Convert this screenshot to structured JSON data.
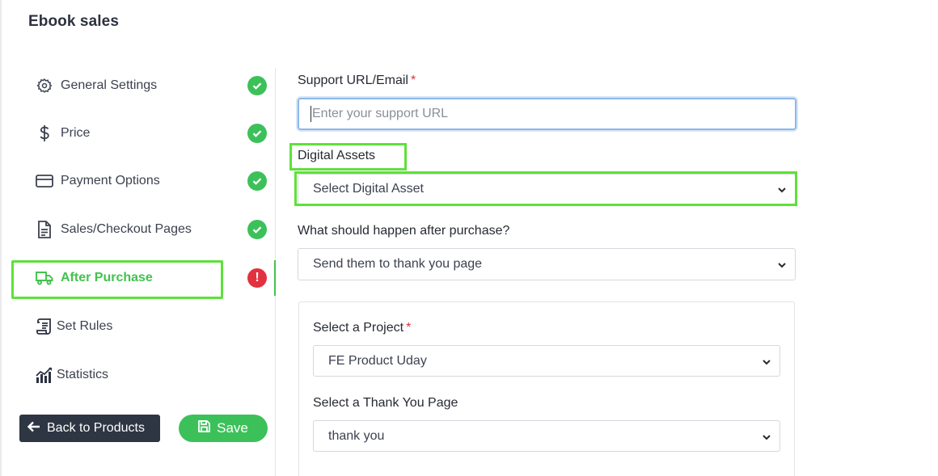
{
  "page": {
    "title": "Ebook sales"
  },
  "sidebar": {
    "items": [
      {
        "label": "General Settings",
        "icon": "gear-icon",
        "status": "complete"
      },
      {
        "label": "Price",
        "icon": "dollar-icon",
        "status": "complete"
      },
      {
        "label": "Payment Options",
        "icon": "credit-card-icon",
        "status": "complete"
      },
      {
        "label": "Sales/Checkout Pages",
        "icon": "document-icon",
        "status": "complete"
      },
      {
        "label": "After Purchase",
        "icon": "truck-icon",
        "status": "error",
        "active": true
      },
      {
        "label": "Set Rules",
        "icon": "scroll-icon"
      },
      {
        "label": "Statistics",
        "icon": "chart-icon"
      }
    ],
    "status_error_glyph": "!",
    "back_label": "Back to Products",
    "save_label": "Save"
  },
  "form": {
    "support": {
      "label": "Support URL/Email",
      "required": "*",
      "placeholder": "Enter your support URL"
    },
    "digital_assets": {
      "label": "Digital Assets",
      "value": "Select Digital Asset"
    },
    "after_purchase": {
      "label": "What should happen after purchase?",
      "value": "Send them to thank you page"
    },
    "project": {
      "label": "Select a Project",
      "required": "*",
      "value": "FE Product Uday"
    },
    "thank_you_page": {
      "label": "Select a Thank You Page",
      "value": "thank you"
    }
  },
  "colors": {
    "accent_green": "#3cc15a",
    "highlight_green": "#5ee13a",
    "error_red": "#e2313f",
    "dark_button": "#2e3543"
  }
}
